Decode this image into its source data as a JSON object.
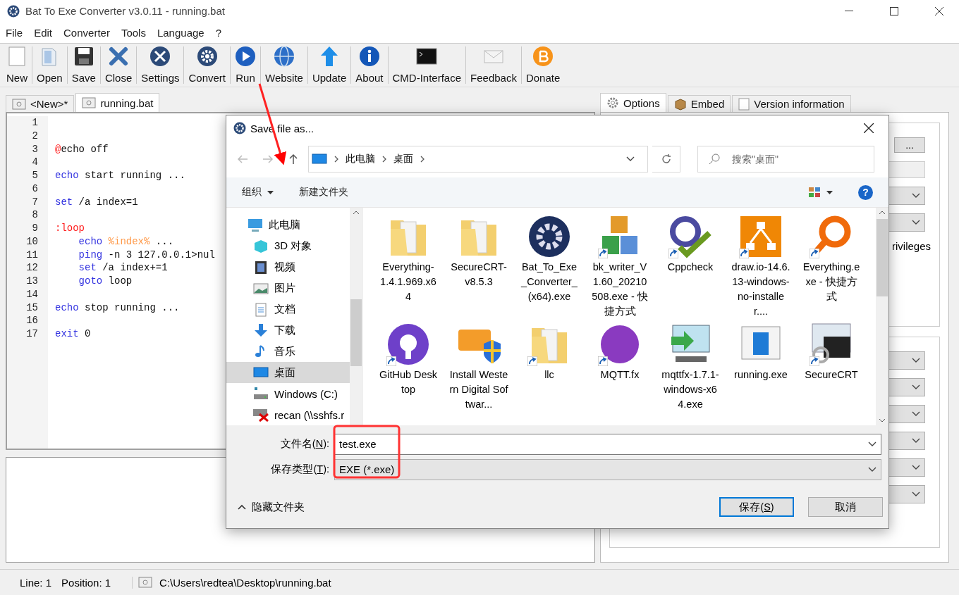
{
  "window": {
    "title": "Bat To Exe Converter v3.0.11 - running.bat"
  },
  "menu": [
    "File",
    "Edit",
    "Converter",
    "Tools",
    "Language",
    "?"
  ],
  "toolbar": [
    "New",
    "Open",
    "Save",
    "Close",
    "Settings",
    "Convert",
    "Run",
    "Website",
    "Update",
    "About",
    "CMD-Interface",
    "Feedback",
    "Donate"
  ],
  "editor_tabs": [
    {
      "label": "<New>*",
      "selected": false
    },
    {
      "label": "running.bat",
      "selected": true
    }
  ],
  "editor": {
    "lines": [
      {
        "number": "1",
        "indented": false
      },
      {
        "number": "2",
        "indented": false
      },
      {
        "number": "3",
        "indented": false,
        "tokens": [
          {
            "kind": "at",
            "text": "@"
          },
          {
            "kind": "plain",
            "text": "echo off"
          }
        ]
      },
      {
        "number": "4",
        "indented": false
      },
      {
        "number": "5",
        "indented": false,
        "tokens": [
          {
            "kind": "keyword",
            "text": "echo"
          },
          {
            "kind": "plain",
            "text": " start running ..."
          }
        ]
      },
      {
        "number": "6",
        "indented": false
      },
      {
        "number": "7",
        "indented": false,
        "tokens": [
          {
            "kind": "keyword",
            "text": "set"
          },
          {
            "kind": "plain",
            "text": " /a index=1"
          }
        ]
      },
      {
        "number": "8",
        "indented": false
      },
      {
        "number": "9",
        "indented": false,
        "tokens": [
          {
            "kind": "label",
            "text": ":loop"
          }
        ]
      },
      {
        "number": "10",
        "indented": true,
        "tokens": [
          {
            "kind": "keyword",
            "text": "echo"
          },
          {
            "kind": "variable",
            "text": " %index%"
          },
          {
            "kind": "plain",
            "text": " ..."
          }
        ]
      },
      {
        "number": "11",
        "indented": true,
        "tokens": [
          {
            "kind": "keyword",
            "text": "ping"
          },
          {
            "kind": "plain",
            "text": " -n 3 127.0.0.1>nul"
          }
        ]
      },
      {
        "number": "12",
        "indented": true,
        "tokens": [
          {
            "kind": "keyword",
            "text": "set"
          },
          {
            "kind": "plain",
            "text": " /a index+=1"
          }
        ]
      },
      {
        "number": "13",
        "indented": true,
        "tokens": [
          {
            "kind": "keyword",
            "text": "goto"
          },
          {
            "kind": "plain",
            "text": " loop"
          }
        ]
      },
      {
        "number": "14",
        "indented": false
      },
      {
        "number": "15",
        "indented": false,
        "tokens": [
          {
            "kind": "keyword",
            "text": "echo"
          },
          {
            "kind": "plain",
            "text": " stop running ..."
          }
        ]
      },
      {
        "number": "16",
        "indented": false
      },
      {
        "number": "17",
        "indented": false,
        "tokens": [
          {
            "kind": "keyword",
            "text": "exit"
          },
          {
            "kind": "plain",
            "text": " 0"
          }
        ]
      }
    ]
  },
  "options_tabs": [
    {
      "label": "Options",
      "selected": true
    },
    {
      "label": "Embed",
      "selected": false
    },
    {
      "label": "Version information",
      "selected": false
    }
  ],
  "options_panel": {
    "browse_button": "...",
    "partial_text": "rivileges"
  },
  "status_bar": {
    "line": "Line: 1",
    "position": "Position: 1",
    "path": "C:\\Users\\redtea\\Desktop\\running.bat"
  },
  "dialog": {
    "title": "Save file as...",
    "breadcrumb": [
      "此电脑",
      "桌面"
    ],
    "search": {
      "placeholder": "搜索\"桌面\""
    },
    "commands": {
      "organize": "组织",
      "new_folder": "新建文件夹",
      "help": "?"
    },
    "nav": [
      {
        "label": "此电脑",
        "selected": false,
        "children": [
          {
            "label": "3D 对象",
            "selected": false
          },
          {
            "label": "视频",
            "selected": false
          },
          {
            "label": "图片",
            "selected": false
          },
          {
            "label": "文档",
            "selected": false
          },
          {
            "label": "下载",
            "selected": false
          },
          {
            "label": "音乐",
            "selected": false
          },
          {
            "label": "桌面",
            "selected": true
          },
          {
            "label": "Windows (C:)",
            "selected": false
          },
          {
            "label": "recan (\\\\sshfs.r",
            "selected": false
          }
        ]
      }
    ],
    "files": [
      {
        "name": "Everything-1.4.1.969.x64",
        "shortcut": false
      },
      {
        "name": "SecureCRT-v8.5.3",
        "shortcut": false
      },
      {
        "name": "Bat_To_Exe_Converter_(x64).exe",
        "shortcut": false
      },
      {
        "name": "bk_writer_V1.60_20210508.exe - 快捷方式",
        "shortcut": true
      },
      {
        "name": "Cppcheck",
        "shortcut": true
      },
      {
        "name": "draw.io-14.6.13-windows-no-installer....",
        "shortcut": true
      },
      {
        "name": "Everything.exe - 快捷方式",
        "shortcut": true
      },
      {
        "name": "GitHub Desktop",
        "shortcut": true
      },
      {
        "name": "Install Western Digital Softwar...",
        "shortcut": false
      },
      {
        "name": "llc",
        "shortcut": true
      },
      {
        "name": "MQTT.fx",
        "shortcut": true
      },
      {
        "name": "mqttfx-1.7.1-windows-x64.exe",
        "shortcut": false
      },
      {
        "name": "running.exe",
        "shortcut": false
      },
      {
        "name": "SecureCRT",
        "shortcut": true
      }
    ],
    "filename": {
      "label": "文件名(",
      "accel": "N",
      "suffix": "):",
      "value": "test.exe"
    },
    "filetype": {
      "label": "保存类型(",
      "accel": "T",
      "suffix": "):",
      "value": "EXE (*.exe)"
    },
    "hide_folders": "隐藏文件夹",
    "buttons": [
      {
        "label": "保存(",
        "accel": "S",
        "suffix": ")",
        "default": true
      },
      {
        "label": "取消",
        "default": false
      }
    ]
  }
}
